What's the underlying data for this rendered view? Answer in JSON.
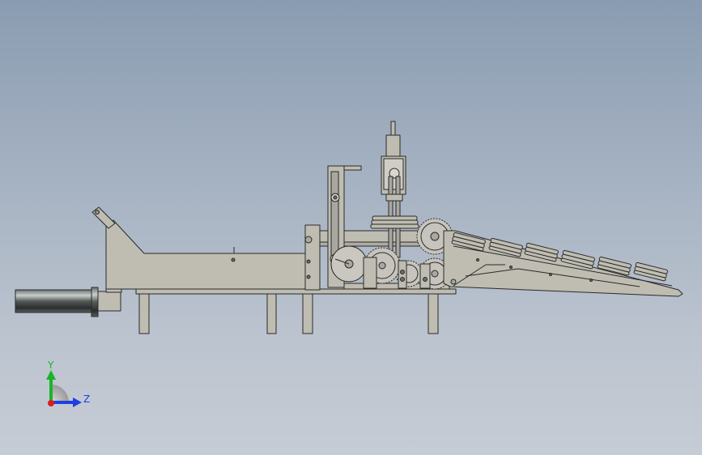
{
  "triad": {
    "y_label": "Y",
    "z_label": "Z",
    "colors": {
      "y": "#19b42c",
      "z": "#1f3fe0",
      "origin": "#d81e1e"
    }
  },
  "colors": {
    "frame_fill": "#bfbdb2",
    "frame_stroke": "#2a2a2a",
    "tube_dark": "#3b3f3f",
    "tube_light": "#b9bfbd"
  }
}
